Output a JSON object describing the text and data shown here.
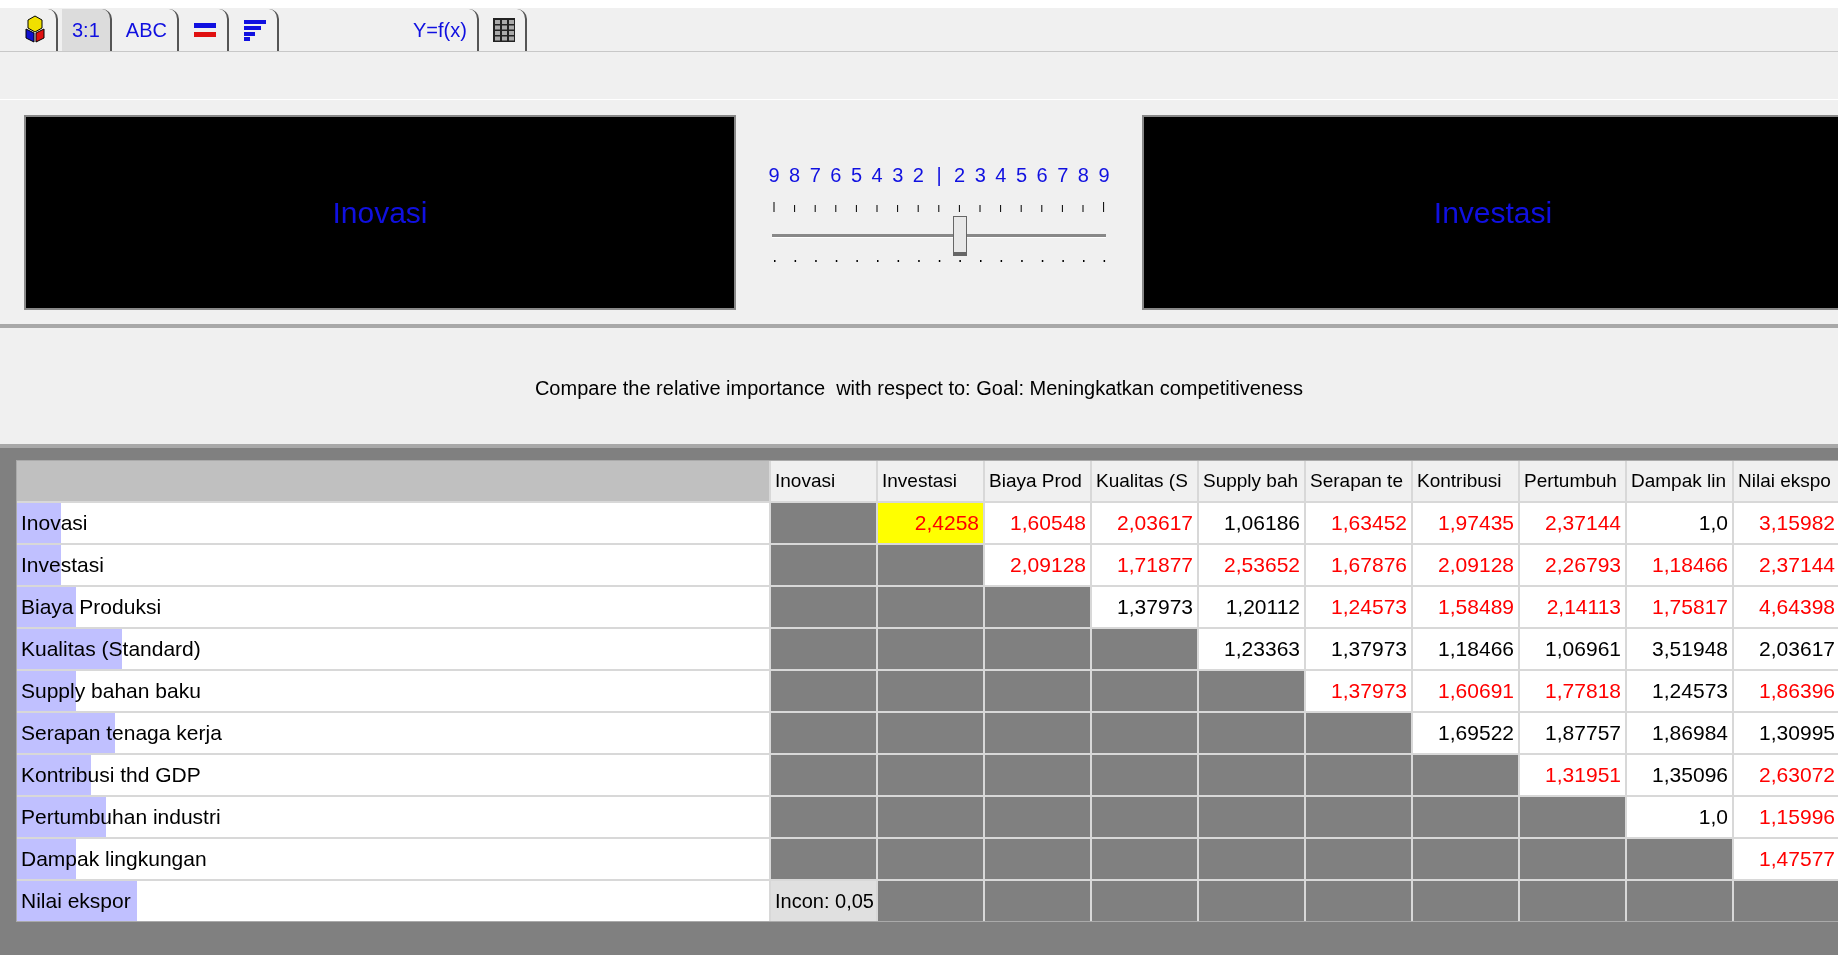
{
  "tabs": [
    {
      "kind": "cubes",
      "selected": false
    },
    {
      "kind": "text",
      "label": "3:1",
      "selected": true
    },
    {
      "kind": "text",
      "label": "ABC",
      "selected": false
    },
    {
      "kind": "bars",
      "selected": false
    },
    {
      "kind": "sort",
      "selected": false
    },
    {
      "kind": "text",
      "label": "Y=f(x)",
      "selected": false
    },
    {
      "kind": "grid",
      "selected": false
    }
  ],
  "comparison": {
    "left": "Inovasi",
    "right": "Investasi",
    "scale": [
      "9",
      "8",
      "7",
      "6",
      "5",
      "4",
      "3",
      "2",
      "|",
      "2",
      "3",
      "4",
      "5",
      "6",
      "7",
      "8",
      "9"
    ],
    "level": 0.5625
  },
  "prompt": "Compare the relative importance  with respect to: Goal: Meningkatkan competitiveness",
  "table": {
    "columns": [
      "Inovasi",
      "Investasi",
      "Biaya Prod",
      "Kualitas (S",
      "Supply bah",
      "Serapan te",
      "Kontribusi",
      "Pertumbuh",
      "Dampak lin",
      "Nilai ekspo"
    ],
    "rows": [
      {
        "label": "Inovasi",
        "level": 0.059,
        "cells": [
          {
            "kind": "blank"
          },
          {
            "value": "2,4258",
            "kind": "inverse",
            "selected": true
          },
          {
            "value": "1,60548",
            "kind": "inverse",
            "selected": false
          },
          {
            "value": "2,03617",
            "kind": "inverse",
            "selected": false
          },
          {
            "value": "1,06186",
            "kind": "direct",
            "selected": false
          },
          {
            "value": "1,63452",
            "kind": "inverse",
            "selected": false
          },
          {
            "value": "1,97435",
            "kind": "inverse",
            "selected": false
          },
          {
            "value": "2,37144",
            "kind": "inverse",
            "selected": false
          },
          {
            "value": "1,0",
            "kind": "direct",
            "selected": false
          },
          {
            "value": "3,15982",
            "kind": "inverse",
            "selected": false
          }
        ]
      },
      {
        "label": "Investasi",
        "level": 0.059,
        "cells": [
          {
            "kind": "blank"
          },
          {
            "kind": "blank"
          },
          {
            "value": "2,09128",
            "kind": "inverse",
            "selected": false
          },
          {
            "value": "1,71877",
            "kind": "inverse",
            "selected": false
          },
          {
            "value": "2,53652",
            "kind": "inverse",
            "selected": false
          },
          {
            "value": "1,67876",
            "kind": "inverse",
            "selected": false
          },
          {
            "value": "2,09128",
            "kind": "inverse",
            "selected": false
          },
          {
            "value": "2,26793",
            "kind": "inverse",
            "selected": false
          },
          {
            "value": "1,18466",
            "kind": "inverse",
            "selected": false
          },
          {
            "value": "2,37144",
            "kind": "inverse",
            "selected": false
          }
        ]
      },
      {
        "label": "Biaya Produksi",
        "level": 0.079,
        "cells": [
          {
            "kind": "blank"
          },
          {
            "kind": "blank"
          },
          {
            "kind": "blank"
          },
          {
            "value": "1,37973",
            "kind": "direct",
            "selected": false
          },
          {
            "value": "1,20112",
            "kind": "direct",
            "selected": false
          },
          {
            "value": "1,24573",
            "kind": "inverse",
            "selected": false
          },
          {
            "value": "1,58489",
            "kind": "inverse",
            "selected": false
          },
          {
            "value": "2,14113",
            "kind": "inverse",
            "selected": false
          },
          {
            "value": "1,75817",
            "kind": "inverse",
            "selected": false
          },
          {
            "value": "4,64398",
            "kind": "inverse",
            "selected": false
          }
        ]
      },
      {
        "label": "Kualitas (Standard)",
        "level": 0.139,
        "cells": [
          {
            "kind": "blank"
          },
          {
            "kind": "blank"
          },
          {
            "kind": "blank"
          },
          {
            "kind": "blank"
          },
          {
            "value": "1,23363",
            "kind": "direct",
            "selected": false
          },
          {
            "value": "1,37973",
            "kind": "direct",
            "selected": false
          },
          {
            "value": "1,18466",
            "kind": "direct",
            "selected": false
          },
          {
            "value": "1,06961",
            "kind": "direct",
            "selected": false
          },
          {
            "value": "3,51948",
            "kind": "direct",
            "selected": false
          },
          {
            "value": "2,03617",
            "kind": "direct",
            "selected": false
          }
        ]
      },
      {
        "label": "Supply bahan baku",
        "level": 0.079,
        "cells": [
          {
            "kind": "blank"
          },
          {
            "kind": "blank"
          },
          {
            "kind": "blank"
          },
          {
            "kind": "blank"
          },
          {
            "kind": "blank"
          },
          {
            "value": "1,37973",
            "kind": "inverse",
            "selected": false
          },
          {
            "value": "1,60691",
            "kind": "inverse",
            "selected": false
          },
          {
            "value": "1,77818",
            "kind": "inverse",
            "selected": false
          },
          {
            "value": "1,24573",
            "kind": "direct",
            "selected": false
          },
          {
            "value": "1,86396",
            "kind": "inverse",
            "selected": false
          }
        ]
      },
      {
        "label": "Serapan tenaga kerja",
        "level": 0.13,
        "cells": [
          {
            "kind": "blank"
          },
          {
            "kind": "blank"
          },
          {
            "kind": "blank"
          },
          {
            "kind": "blank"
          },
          {
            "kind": "blank"
          },
          {
            "kind": "blank"
          },
          {
            "value": "1,69522",
            "kind": "direct",
            "selected": false
          },
          {
            "value": "1,87757",
            "kind": "direct",
            "selected": false
          },
          {
            "value": "1,86984",
            "kind": "direct",
            "selected": false
          },
          {
            "value": "1,30995",
            "kind": "direct",
            "selected": false
          }
        ]
      },
      {
        "label": "Kontribusi thd GDP",
        "level": 0.099,
        "cells": [
          {
            "kind": "blank"
          },
          {
            "kind": "blank"
          },
          {
            "kind": "blank"
          },
          {
            "kind": "blank"
          },
          {
            "kind": "blank"
          },
          {
            "kind": "blank"
          },
          {
            "kind": "blank"
          },
          {
            "value": "1,31951",
            "kind": "inverse",
            "selected": false
          },
          {
            "value": "1,35096",
            "kind": "direct",
            "selected": false
          },
          {
            "value": "2,63072",
            "kind": "inverse",
            "selected": false
          }
        ]
      },
      {
        "label": "Pertumbuhan industri",
        "level": 0.119,
        "cells": [
          {
            "kind": "blank"
          },
          {
            "kind": "blank"
          },
          {
            "kind": "blank"
          },
          {
            "kind": "blank"
          },
          {
            "kind": "blank"
          },
          {
            "kind": "blank"
          },
          {
            "kind": "blank"
          },
          {
            "kind": "blank"
          },
          {
            "value": "1,0",
            "kind": "direct",
            "selected": false
          },
          {
            "value": "1,15996",
            "kind": "inverse",
            "selected": false
          }
        ]
      },
      {
        "label": "Dampak lingkungan",
        "level": 0.079,
        "cells": [
          {
            "kind": "blank"
          },
          {
            "kind": "blank"
          },
          {
            "kind": "blank"
          },
          {
            "kind": "blank"
          },
          {
            "kind": "blank"
          },
          {
            "kind": "blank"
          },
          {
            "kind": "blank"
          },
          {
            "kind": "blank"
          },
          {
            "kind": "blank"
          },
          {
            "value": "1,47577",
            "kind": "inverse",
            "selected": false
          }
        ]
      },
      {
        "label": "Nilai ekspor",
        "level": 0.159,
        "cells": [
          {
            "value": "Incon: 0,05",
            "kind": "note"
          },
          {
            "kind": "blank"
          },
          {
            "kind": "blank"
          },
          {
            "kind": "blank"
          },
          {
            "kind": "blank"
          },
          {
            "kind": "blank"
          },
          {
            "kind": "blank"
          },
          {
            "kind": "blank"
          },
          {
            "kind": "blank"
          },
          {
            "kind": "blank"
          }
        ]
      }
    ]
  }
}
